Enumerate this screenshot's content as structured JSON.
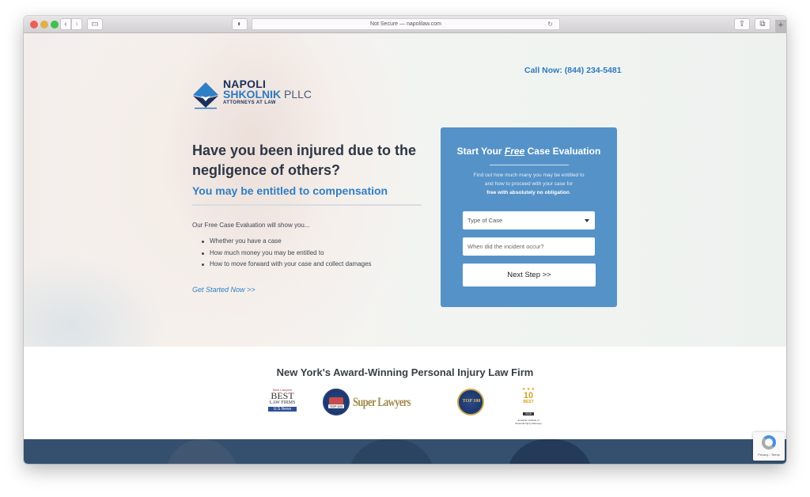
{
  "browser": {
    "address": "Not Secure — napolilaw.com",
    "back_glyph": "‹",
    "forward_glyph": "›",
    "sidebar_glyph": "▭",
    "privacy_glyph": "◐",
    "reload_glyph": "↻",
    "share_glyph": "⇪",
    "tabs_glyph": "⧉",
    "newtab_glyph": "+"
  },
  "header": {
    "logo": {
      "line1": "NAPOLI",
      "line2_main": "SHKOLNIK",
      "line2_suffix": " PLLC",
      "line3": "ATTORNEYS AT LAW"
    },
    "call_now": "Call Now: (844) 234-5481"
  },
  "hero": {
    "headline": "Have you been injured due to the negligence of others?",
    "subhead": "You may be entitled to compensation",
    "intro": "Our Free Case Evaluation will show you...",
    "bullets": [
      "Whether you have a case",
      "How much money you may be entitled to",
      "How to move forward with your case and collect damages"
    ],
    "cta_link": "Get Started Now >>"
  },
  "form": {
    "title_pre": "Start Your ",
    "title_em": "Free",
    "title_post": " Case Evaluation",
    "desc_line1": "Find out how much many you may be entitled to",
    "desc_line2": "and how to proceed with your case for",
    "desc_bold": "free with absolutely no obligation",
    "desc_end": ".",
    "case_type_selected": "Type of Case",
    "incident_placeholder": "When did the incident occur?",
    "submit_label": "Next Step >>",
    "accent_color": "#5592c8"
  },
  "awards": {
    "title": "New York's Award-Winning Personal Injury Law Firm",
    "badges": [
      {
        "name": "best-law-firms",
        "top": "Best Lawyers",
        "main": "BEST",
        "sub": "LAW FIRMS",
        "ribbon": "U.S.News"
      },
      {
        "name": "top-100-seal",
        "label": "TOP 100"
      },
      {
        "name": "super-lawyers",
        "label": "Super Lawyers"
      },
      {
        "name": "national-trial-lawyers-top-100",
        "label": "TOP 100"
      },
      {
        "name": "10-best",
        "stars": "★ ★ ★",
        "num": "10",
        "best": "BEST",
        "year": "2018",
        "org": "American Institute of Personal Injury Attorneys"
      }
    ]
  },
  "recaptcha": {
    "text": "Privacy - Terms"
  }
}
